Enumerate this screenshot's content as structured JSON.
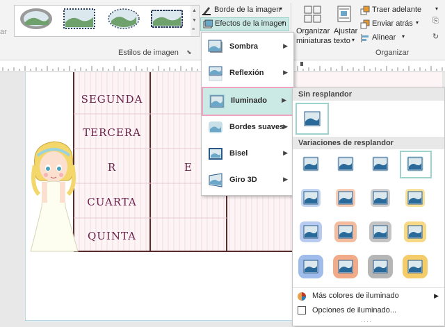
{
  "ribbon": {
    "styles_group_label": "Estilos de imagen",
    "border_label": "Borde de la imagen",
    "effects_label": "Efectos de la imagen",
    "arrange_group_label": "Organizar",
    "thumbnails_label_1": "Organizar",
    "thumbnails_label_2": "miniaturas",
    "fit_text_label_1": "Ajustar",
    "fit_text_label_2": "texto",
    "bring_forward_label": "Traer adelante",
    "send_backward_label": "Enviar atrás",
    "align_label": "Alinear",
    "left_cut_label": "ar"
  },
  "document": {
    "words": [
      "SEGUNDA",
      "TERCERA",
      "R",
      "CUARTA",
      "QUINTA"
    ],
    "middle_letter": "E",
    "accent_color": "#5a2a2a"
  },
  "effects_menu": {
    "items": [
      {
        "label": "Sombra"
      },
      {
        "label": "Reflexión"
      },
      {
        "label": "Iluminado"
      },
      {
        "label": "Bordes suaves"
      },
      {
        "label": "Bisel"
      },
      {
        "label": "Giro 3D"
      }
    ],
    "active_index": 2
  },
  "glow_submenu": {
    "no_glow_header": "Sin resplandor",
    "variations_header": "Variaciones de resplandor",
    "more_colors_label": "Más colores de iluminado",
    "options_label": "Opciones de iluminado...",
    "rows": [
      [
        "#d8e6ea",
        "#d8e6ea",
        "#d8e6ea",
        "#c2e3e1"
      ],
      [
        "#b6cdee",
        "#f6c3a8",
        "#c9c9c9",
        "#f6dd8c"
      ],
      [
        "#a9c2ec",
        "#f2b08e",
        "#b8b8b8",
        "#f4d170"
      ],
      [
        "#8fb0e6",
        "#ee9c74",
        "#a9a9a9",
        "#f2c450"
      ]
    ]
  }
}
